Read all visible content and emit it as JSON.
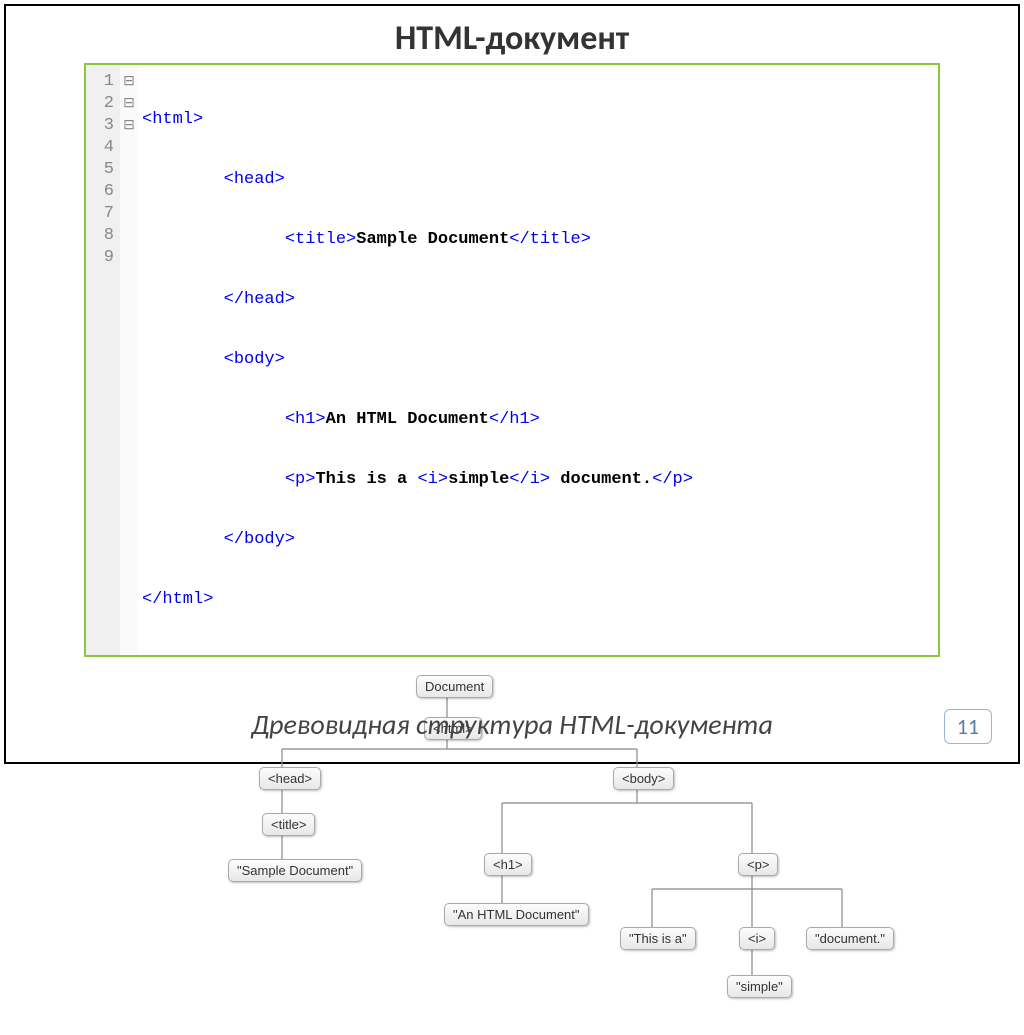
{
  "title": "HTML-документ",
  "caption": "Древовидная структура HTML-документа",
  "page_number": "11",
  "code": {
    "line_numbers": [
      "1",
      "2",
      "3",
      "4",
      "5",
      "6",
      "7",
      "8",
      "9"
    ],
    "fold_marks": [
      "⊟",
      "⊟",
      "",
      "",
      "⊟",
      "",
      "",
      "",
      ""
    ],
    "lines": [
      {
        "tag_open": "<html>",
        "text": "",
        "tag_close": ""
      },
      {
        "indent": "        ",
        "tag_open": "<head>",
        "text": "",
        "tag_close": ""
      },
      {
        "indent": "              ",
        "tag_open": "<title>",
        "text": "Sample Document",
        "tag_close": "</title>"
      },
      {
        "indent": "        ",
        "tag_open": "</head>",
        "text": "",
        "tag_close": ""
      },
      {
        "indent": "        ",
        "tag_open": "<body>",
        "text": "",
        "tag_close": ""
      },
      {
        "indent": "              ",
        "tag_open": "<h1>",
        "text": "An HTML Document",
        "tag_close": "</h1>"
      },
      {
        "indent": "              ",
        "tag_open": "<p>",
        "text_a": "This is a ",
        "tag_i_open": "<i>",
        "text_i": "simple",
        "tag_i_close": "</i>",
        "text_b": " document.",
        "tag_close": "</p>"
      },
      {
        "indent": "        ",
        "tag_open": "</body>",
        "text": "",
        "tag_close": ""
      },
      {
        "indent": "",
        "tag_open": "</html>",
        "text": "",
        "tag_close": ""
      }
    ]
  },
  "tree": {
    "document": "Document",
    "html": "<html>",
    "head": "<head>",
    "title": "<title>",
    "sample_doc": "\"Sample Document\"",
    "body": "<body>",
    "h1": "<h1>",
    "h1_text": "\"An HTML Document\"",
    "p": "<p>",
    "p_text_a": "\"This is a\"",
    "i": "<i>",
    "i_text": "\"simple\"",
    "p_text_b": "\"document.\""
  }
}
